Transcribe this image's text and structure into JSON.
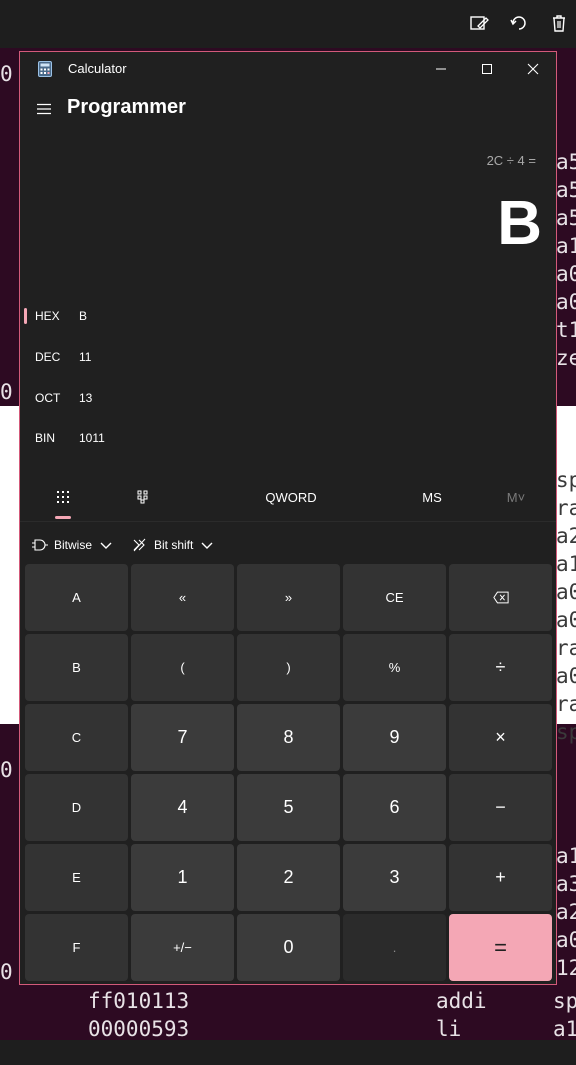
{
  "window": {
    "title": "Calculator"
  },
  "header": {
    "mode": "Programmer"
  },
  "display": {
    "expression": "2C ÷ 4 =",
    "result": "B"
  },
  "radix": [
    {
      "label": "HEX",
      "value": "B",
      "selected": true
    },
    {
      "label": "DEC",
      "value": "11",
      "selected": false
    },
    {
      "label": "OCT",
      "value": "13",
      "selected": false
    },
    {
      "label": "BIN",
      "value": "1011",
      "selected": false
    }
  ],
  "tools": {
    "word_size": "QWORD",
    "ms": "MS",
    "mv": "M˅"
  },
  "ops": {
    "bitwise": "Bitwise",
    "bitshift": "Bit shift"
  },
  "keys": [
    [
      "A",
      "«",
      "»",
      "CE",
      "⌫"
    ],
    [
      "B",
      "(",
      ")",
      "%",
      "÷"
    ],
    [
      "C",
      "7",
      "8",
      "9",
      "×"
    ],
    [
      "D",
      "4",
      "5",
      "6",
      "−"
    ],
    [
      "E",
      "1",
      "2",
      "3",
      "+"
    ],
    [
      "F",
      "+/−",
      "0",
      ".",
      "="
    ]
  ],
  "background": {
    "left_fragments": [
      "0",
      "0",
      "0",
      "0"
    ],
    "right_col_1": [
      "a5",
      "a5",
      "a5",
      "a1",
      "a0",
      "a0",
      "t1",
      "ze"
    ],
    "right_col_2": [
      "sp",
      "ra",
      "a2",
      "a1",
      "a0",
      "a0",
      "ra",
      "a0",
      "ra",
      "sp"
    ],
    "right_col_3": [
      "a1",
      "a3",
      "a2",
      "a0",
      "12"
    ],
    "bottom_lines": [
      {
        "code": "ff010113",
        "op": "addi",
        "reg": "sp"
      },
      {
        "code": "00000593",
        "op": "li",
        "reg": "a1"
      }
    ]
  },
  "colors": {
    "accent": "#f4a7b5",
    "window_border": "#d35a7a",
    "bg": "#202020"
  }
}
